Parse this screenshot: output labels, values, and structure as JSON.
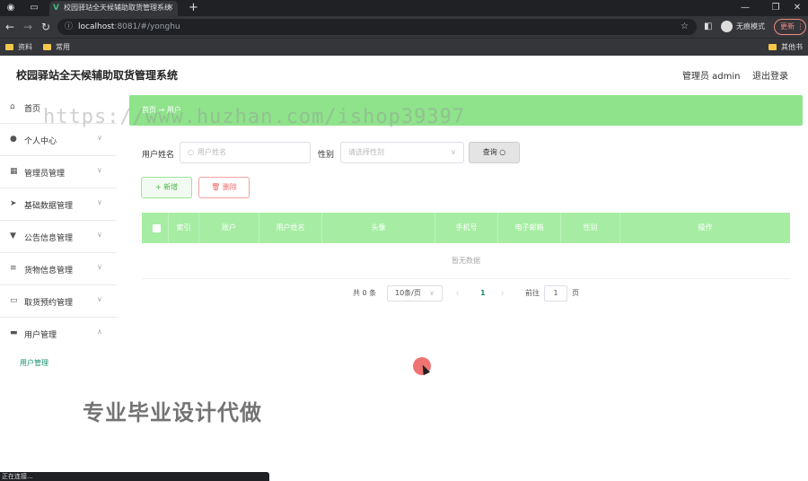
{
  "browser": {
    "tab_title": "校园驿站全天候辅助取货管理系统",
    "url_host": "localhost",
    "url_path": ":8081/#/yonghu",
    "incognito_label": "无痕模式",
    "update_label": "更新",
    "bookmarks": [
      "资料",
      "常用",
      "其他书签"
    ],
    "status_text": "正在连接..."
  },
  "header": {
    "title": "校园驿站全天候辅助取货管理系统",
    "admin_label": "管理员 admin",
    "logout_label": "退出登录"
  },
  "sidebar": {
    "items": [
      {
        "label": "首页",
        "icon": "home-icon"
      },
      {
        "label": "个人中心",
        "icon": "user-icon"
      },
      {
        "label": "管理员管理",
        "icon": "admin-icon"
      },
      {
        "label": "基础数据管理",
        "icon": "send-icon"
      },
      {
        "label": "公告信息管理",
        "icon": "notice-icon"
      },
      {
        "label": "货物信息管理",
        "icon": "sliders-icon"
      },
      {
        "label": "取货预约管理",
        "icon": "chat-icon"
      },
      {
        "label": "用户管理",
        "icon": "folder-icon"
      }
    ],
    "submenu_label": "用户管理"
  },
  "breadcrumb": {
    "text": "首页 → 用户"
  },
  "search": {
    "name_label": "用户姓名",
    "name_placeholder": "用户姓名",
    "gender_label": "性别",
    "gender_placeholder": "请选择性别",
    "query_label": "查询"
  },
  "actions": {
    "add_label": "新增",
    "delete_label": "删除"
  },
  "table": {
    "columns": [
      "索引",
      "账户",
      "用户姓名",
      "头像",
      "手机号",
      "电子邮箱",
      "性别",
      "操作"
    ],
    "empty_text": "暂无数据"
  },
  "pagination": {
    "total_text": "共 0 条",
    "page_size": "10条/页",
    "current_page": "1",
    "goto_label": "前往",
    "goto_value": "1",
    "page_unit": "页"
  },
  "overlay": {
    "watermark": "https://www.huzhan.com/ishop39397",
    "promo": "专业毕业设计代做"
  },
  "colors": {
    "primary": "#8ee38b",
    "table_header": "#a6eda3",
    "accent": "#1a8f6e",
    "danger": "#e86b6b"
  }
}
